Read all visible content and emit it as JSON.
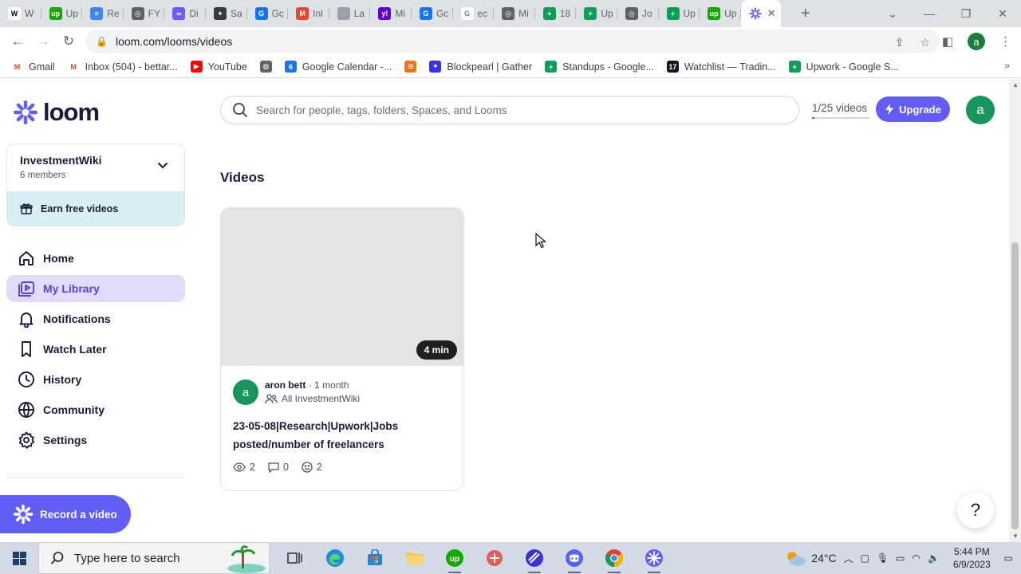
{
  "browser": {
    "tabs": [
      {
        "label": "W",
        "fav_color": "#ffffff",
        "fav_text": "W",
        "fav_fg": "#000000"
      },
      {
        "label": "Up",
        "fav_color": "#14a800",
        "fav_text": "up"
      },
      {
        "label": "Re",
        "fav_color": "#4285f4",
        "fav_text": "≡"
      },
      {
        "label": "FY",
        "fav_color": "#5f6368",
        "fav_text": "◎"
      },
      {
        "label": "Di",
        "fav_color": "#6d5df5",
        "fav_text": "∞"
      },
      {
        "label": "Sa",
        "fav_color": "#3a3a3a",
        "fav_text": "✦"
      },
      {
        "label": "Gc",
        "fav_color": "#1a73e8",
        "fav_text": "G"
      },
      {
        "label": "Inl",
        "fav_color": "#ea4335",
        "fav_text": "M"
      },
      {
        "label": "La",
        "fav_color": "#9aa0a6",
        "fav_text": "◌"
      },
      {
        "label": "Mi",
        "fav_color": "#6001d2",
        "fav_text": "y!"
      },
      {
        "label": "Gc",
        "fav_color": "#1a73e8",
        "fav_text": "G"
      },
      {
        "label": "ec",
        "fav_color": "#ffffff",
        "fav_text": "G",
        "fav_fg": "#4285f4"
      },
      {
        "label": "Mi",
        "fav_color": "#5f6368",
        "fav_text": "◎"
      },
      {
        "label": "18",
        "fav_color": "#0f9d58",
        "fav_text": "+"
      },
      {
        "label": "Up",
        "fav_color": "#0f9d58",
        "fav_text": "+"
      },
      {
        "label": "Jo",
        "fav_color": "#5f6368",
        "fav_text": "◎"
      },
      {
        "label": "Up",
        "fav_color": "#0f9d58",
        "fav_text": "+"
      },
      {
        "label": "Up",
        "fav_color": "#14a800",
        "fav_text": "up"
      }
    ],
    "active_tab_close": "✕",
    "new_tab": "+",
    "url": "loom.com/looms/videos",
    "profile_initial": "a",
    "bookmarks": [
      {
        "label": "Gmail",
        "fav_color": "#ffffff",
        "fav_text": "M",
        "fav_fg": "#ea4335"
      },
      {
        "label": "Inbox (504) - bettar...",
        "fav_color": "#ffffff",
        "fav_text": "M",
        "fav_fg": "#ea4335"
      },
      {
        "label": "YouTube",
        "fav_color": "#ff0000",
        "fav_text": "▶"
      },
      {
        "label": "",
        "fav_color": "#5f6368",
        "fav_text": "◍"
      },
      {
        "label": "Google Calendar -...",
        "fav_color": "#1a73e8",
        "fav_text": "6"
      },
      {
        "label": "",
        "fav_color": "#f97316",
        "fav_text": "≋"
      },
      {
        "label": "Blockpearl | Gather",
        "fav_color": "#3b32d8",
        "fav_text": "✦"
      },
      {
        "label": "Standups - Google...",
        "fav_color": "#0f9d58",
        "fav_text": "+"
      },
      {
        "label": "Watchlist — Tradin...",
        "fav_color": "#131722",
        "fav_text": "17"
      },
      {
        "label": "Upwork - Google S...",
        "fav_color": "#0f9d58",
        "fav_text": "+"
      }
    ],
    "bookmarks_more": "»"
  },
  "app": {
    "logo_text": "loom",
    "workspace": {
      "name": "InvestmentWiki",
      "members": "6 members"
    },
    "earn_label": "Earn free videos",
    "nav": [
      {
        "label": "Home",
        "icon": "home-icon"
      },
      {
        "label": "My Library",
        "icon": "library-icon",
        "active": true
      },
      {
        "label": "Notifications",
        "icon": "bell-icon"
      },
      {
        "label": "Watch Later",
        "icon": "bookmark-icon"
      },
      {
        "label": "History",
        "icon": "clock-icon"
      },
      {
        "label": "Community",
        "icon": "globe-icon"
      },
      {
        "label": "Settings",
        "icon": "gear-icon"
      }
    ],
    "record_label": "Record a video",
    "search_placeholder": "Search for people, tags, folders, Spaces, and Looms",
    "quota_label": "1/25 videos",
    "quota_fraction": 0.04,
    "upgrade_label": "Upgrade",
    "user_initial": "a",
    "section_title": "Videos",
    "videos": [
      {
        "duration": "4 min",
        "author_initial": "a",
        "author": "aron bett",
        "separator": "·",
        "age": "1 month",
        "audience": "All InvestmentWiki",
        "title": "23-05-08|Research|Upwork|Jobs posted/number of freelancers",
        "views": "2",
        "comments": "0",
        "reactions": "2"
      }
    ],
    "help_label": "?",
    "accent": "#625df5"
  },
  "taskbar": {
    "search_placeholder": "Type here to search",
    "temperature": "24°C",
    "time": "5:44 PM",
    "date": "6/9/2023"
  }
}
